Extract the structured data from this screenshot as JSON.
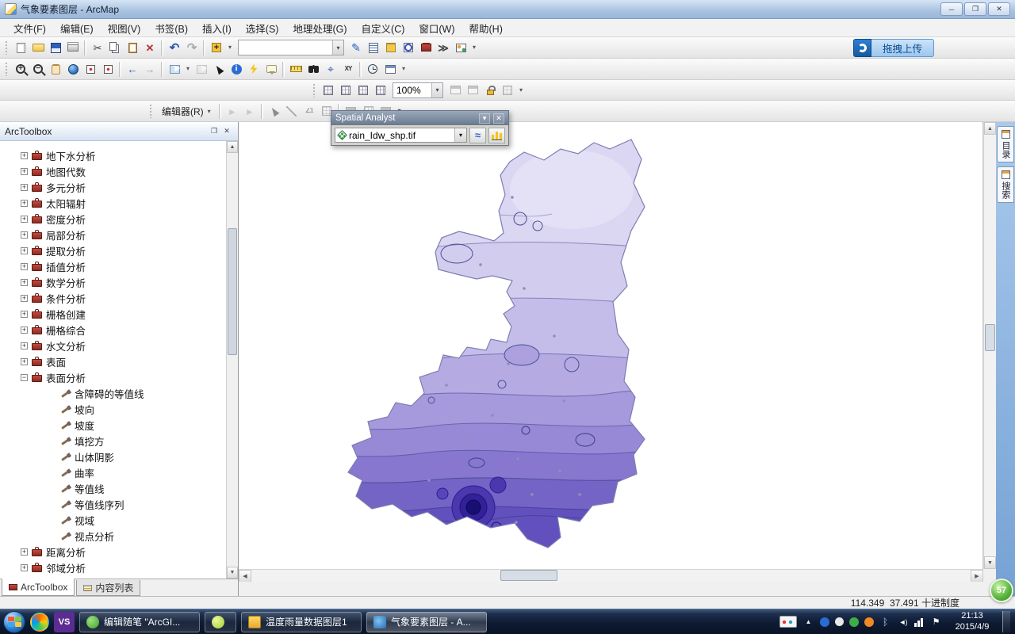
{
  "glyphs": {
    "drop": "▾",
    "close": "✕",
    "min": "─",
    "max": "❐",
    "up": "▲",
    "down": "▼",
    "left": "◀",
    "right": "▶",
    "windowed": "❐"
  },
  "window": {
    "title": "气象要素图层 - ArcMap"
  },
  "menu": {
    "items": [
      "文件(F)",
      "编辑(E)",
      "视图(V)",
      "书签(B)",
      "插入(I)",
      "选择(S)",
      "地理处理(G)",
      "自定义(C)",
      "窗口(W)",
      "帮助(H)"
    ]
  },
  "upload": {
    "label": "拖拽上传"
  },
  "toolbar1": {
    "scale_value": "",
    "left": [
      {
        "name": "new-document-button",
        "cls": "ic-new"
      },
      {
        "name": "open-button",
        "cls": "ic-open"
      },
      {
        "name": "save-button",
        "cls": "ic-save"
      },
      {
        "name": "print-button",
        "cls": "ic-print"
      },
      {
        "name": "toolbar-separator",
        "cls": "tsep",
        "inter": "false"
      },
      {
        "name": "cut-button",
        "cls": "ic-cut",
        "glyph": "✂"
      },
      {
        "name": "copy-button",
        "cls": "ic-copy"
      },
      {
        "name": "paste-button",
        "cls": "ic-paste"
      },
      {
        "name": "delete-button",
        "cls": "ic-del",
        "glyph": "✕"
      },
      {
        "name": "toolbar-separator",
        "cls": "tsep",
        "inter": "false"
      },
      {
        "name": "undo-button",
        "cls": "ic-undo",
        "glyph": "↶"
      },
      {
        "name": "redo-button",
        "cls": "ic-redo",
        "glyph": "↷"
      },
      {
        "name": "toolbar-separator",
        "cls": "tsep",
        "inter": "false"
      },
      {
        "name": "add-data-button",
        "cls": "ic-adddata",
        "glyph": "+"
      },
      {
        "name": "add-data-dropdown",
        "cls": "tdrop",
        "glyph": "▾"
      }
    ],
    "right": [
      {
        "name": "editor-toggle-button",
        "cls": "ic-pencil",
        "glyph": "✎"
      },
      {
        "name": "table-of-contents-button",
        "cls": "ic-toc"
      },
      {
        "name": "catalog-window-button",
        "cls": "ic-catalog"
      },
      {
        "name": "search-window-button",
        "cls": "ic-searchwin"
      },
      {
        "name": "arctoolbox-window-button",
        "cls": "ic-toolboxred"
      },
      {
        "name": "python-window-button",
        "cls": "ic-python",
        "glyph": "≫"
      },
      {
        "name": "modelbuilder-button",
        "cls": "ic-model"
      },
      {
        "name": "standard-toolbar-dropdown",
        "cls": "tdrop",
        "glyph": "▾"
      }
    ]
  },
  "toolbar2": {
    "icons": [
      {
        "name": "zoom-in-button",
        "cls": "ic-zoomin",
        "glyph": "+"
      },
      {
        "name": "zoom-out-button",
        "cls": "ic-zoomout",
        "glyph": "−"
      },
      {
        "name": "pan-button",
        "cls": "ic-hand"
      },
      {
        "name": "full-extent-button",
        "cls": "ic-globe"
      },
      {
        "name": "fixed-zoom-in-button",
        "cls": "ic-fz"
      },
      {
        "name": "fixed-zoom-out-button",
        "cls": "ic-fz"
      },
      {
        "name": "toolbar-separator",
        "cls": "tsep",
        "inter": "false"
      },
      {
        "name": "back-extent-button",
        "cls": "ic-blue",
        "glyph": "←"
      },
      {
        "name": "forward-extent-button",
        "cls": "ic-gray",
        "glyph": "→"
      },
      {
        "name": "toolbar-separator",
        "cls": "tsep",
        "inter": "false"
      },
      {
        "name": "select-features-button",
        "cls": "ic-selfeat"
      },
      {
        "name": "select-features-dropdown",
        "cls": "tdrop",
        "glyph": "▾"
      },
      {
        "name": "clear-selection-button",
        "cls": "ic-selfeat dim"
      },
      {
        "name": "select-elements-button",
        "cls": "ic-cursor"
      },
      {
        "name": "identify-button",
        "cls": "ic-info",
        "glyph": "i"
      },
      {
        "name": "hyperlink-button",
        "cls": "ic-lightning"
      },
      {
        "name": "html-popup-button",
        "cls": "ic-popup"
      },
      {
        "name": "toolbar-separator",
        "cls": "tsep",
        "inter": "false"
      },
      {
        "name": "measure-button",
        "cls": "ic-ruler"
      },
      {
        "name": "find-button",
        "cls": "ic-binoc"
      },
      {
        "name": "find-route-button",
        "cls": "ic-route",
        "glyph": "⌖"
      },
      {
        "name": "go-to-xy-button",
        "cls": "ic-xy",
        "glyph": "XY"
      },
      {
        "name": "toolbar-separator",
        "cls": "tsep",
        "inter": "false"
      },
      {
        "name": "time-slider-button",
        "cls": "ic-clockcss"
      },
      {
        "name": "viewer-window-button",
        "cls": "ic-viewer"
      },
      {
        "name": "tools-toolbar-dropdown",
        "cls": "tdrop",
        "glyph": "▾"
      }
    ]
  },
  "toolbar3": {
    "zoom_value": "100%",
    "left": [
      {
        "name": "zoom-whole-page-button",
        "cls": "ic-grid"
      },
      {
        "name": "zoom-100-button",
        "cls": "ic-grid"
      },
      {
        "name": "zoom-page-width-button",
        "cls": "ic-grid"
      },
      {
        "name": "toggle-draft-mode-button",
        "cls": "ic-grid"
      }
    ],
    "right": [
      {
        "name": "focus-data-frame-button",
        "cls": "ic-viewer dim"
      },
      {
        "name": "change-layout-button",
        "cls": "ic-viewer dim"
      },
      {
        "name": "lock-pan-zoom-button",
        "cls": "ic-lock"
      },
      {
        "name": "data-driven-pages-button",
        "cls": "ic-grid dim"
      },
      {
        "name": "layout-toolbar-dropdown",
        "cls": "tdrop",
        "glyph": "▾"
      }
    ]
  },
  "editor_toolbar": {
    "label": "编辑器(R)",
    "icons": [
      {
        "name": "editor-prev-button",
        "cls": "ic-gray dim",
        "glyph": "▸"
      },
      {
        "name": "editor-next-button",
        "cls": "ic-gray dim",
        "glyph": "▸"
      },
      {
        "name": "toolbar-separator",
        "cls": "tsep",
        "inter": "false"
      },
      {
        "name": "edit-tool-button",
        "cls": "ic-cursor dim"
      },
      {
        "name": "straight-segment-button",
        "cls": "ic-line dim"
      },
      {
        "name": "construction-tool-button",
        "cls": "ic-xy dim",
        "glyph": "∠1"
      },
      {
        "name": "trace-tool-button",
        "cls": "ic-grid dim"
      },
      {
        "name": "toolbar-separator",
        "cls": "tsep",
        "inter": "false"
      },
      {
        "name": "attributes-button",
        "cls": "ic-viewer dim"
      },
      {
        "name": "sketch-properties-button",
        "cls": "ic-grid dim"
      },
      {
        "name": "create-features-button",
        "cls": "ic-viewer dim"
      },
      {
        "name": "editor-toolbar-dropdown",
        "cls": "tdrop",
        "glyph": "▾"
      }
    ]
  },
  "spatial_analyst": {
    "title": "Spatial Analyst",
    "layer_value": "rain_Idw_shp.tif"
  },
  "arctoolbox": {
    "title": "ArcToolbox",
    "items": [
      {
        "label": "地下水分析",
        "kind": "lvl0",
        "expander": "plus",
        "icon": "toolbox",
        "icname": "toolbox-icon"
      },
      {
        "label": "地图代数",
        "kind": "lvl0",
        "expander": "plus",
        "icon": "toolbox",
        "icname": "toolbox-icon"
      },
      {
        "label": "多元分析",
        "kind": "lvl0",
        "expander": "plus",
        "icon": "toolbox",
        "icname": "toolbox-icon"
      },
      {
        "label": "太阳辐射",
        "kind": "lvl0",
        "expander": "plus",
        "icon": "toolbox",
        "icname": "toolbox-icon"
      },
      {
        "label": "密度分析",
        "kind": "lvl0",
        "expander": "plus",
        "icon": "toolbox",
        "icname": "toolbox-icon"
      },
      {
        "label": "局部分析",
        "kind": "lvl0",
        "expander": "plus",
        "icon": "toolbox",
        "icname": "toolbox-icon"
      },
      {
        "label": "提取分析",
        "kind": "lvl0",
        "expander": "plus",
        "icon": "toolbox",
        "icname": "toolbox-icon"
      },
      {
        "label": "插值分析",
        "kind": "lvl0",
        "expander": "plus",
        "icon": "toolbox",
        "icname": "toolbox-icon"
      },
      {
        "label": "数学分析",
        "kind": "lvl0",
        "expander": "plus",
        "icon": "toolbox",
        "icname": "toolbox-icon"
      },
      {
        "label": "条件分析",
        "kind": "lvl0",
        "expander": "plus",
        "icon": "toolbox",
        "icname": "toolbox-icon"
      },
      {
        "label": "栅格创建",
        "kind": "lvl0",
        "expander": "plus",
        "icon": "toolbox",
        "icname": "toolbox-icon"
      },
      {
        "label": "栅格综合",
        "kind": "lvl0",
        "expander": "plus",
        "icon": "toolbox",
        "icname": "toolbox-icon"
      },
      {
        "label": "水文分析",
        "kind": "lvl0",
        "expander": "plus",
        "icon": "toolbox",
        "icname": "toolbox-icon"
      },
      {
        "label": "表面",
        "kind": "lvl0",
        "expander": "plus",
        "icon": "toolbox",
        "icname": "toolbox-icon"
      },
      {
        "label": "表面分析",
        "kind": "lvl0",
        "expander": "minus",
        "icon": "toolbox",
        "icname": "toolbox-icon"
      },
      {
        "label": "含障碍的等值线",
        "kind": "lvl1",
        "expander": "none",
        "icon": "tool",
        "icname": "tool-hammer-icon"
      },
      {
        "label": "坡向",
        "kind": "lvl1",
        "expander": "none",
        "icon": "tool",
        "icname": "tool-hammer-icon"
      },
      {
        "label": "坡度",
        "kind": "lvl1",
        "expander": "none",
        "icon": "tool",
        "icname": "tool-hammer-icon"
      },
      {
        "label": "填挖方",
        "kind": "lvl1",
        "expander": "none",
        "icon": "tool",
        "icname": "tool-hammer-icon"
      },
      {
        "label": "山体阴影",
        "kind": "lvl1",
        "expander": "none",
        "icon": "tool",
        "icname": "tool-hammer-icon"
      },
      {
        "label": "曲率",
        "kind": "lvl1",
        "expander": "none",
        "icon": "tool",
        "icname": "tool-hammer-icon"
      },
      {
        "label": "等值线",
        "kind": "lvl1",
        "expander": "none",
        "icon": "tool",
        "icname": "tool-hammer-icon"
      },
      {
        "label": "等值线序列",
        "kind": "lvl1",
        "expander": "none",
        "icon": "tool",
        "icname": "tool-hammer-icon"
      },
      {
        "label": "视域",
        "kind": "lvl1",
        "expander": "none",
        "icon": "tool",
        "icname": "tool-hammer-icon"
      },
      {
        "label": "视点分析",
        "kind": "lvl1",
        "expander": "none",
        "icon": "tool",
        "icname": "tool-hammer-icon"
      },
      {
        "label": "距离分析",
        "kind": "lvl0",
        "expander": "plus",
        "icon": "toolbox",
        "icname": "toolbox-icon"
      },
      {
        "label": "邻域分析",
        "kind": "lvl0",
        "expander": "plus",
        "icon": "toolbox",
        "icname": "toolbox-icon"
      }
    ],
    "tabs": [
      {
        "label": "ArcToolbox",
        "cls": "active",
        "icon": "tab-red"
      },
      {
        "label": "内容列表",
        "cls": "",
        "icon": "tab-list"
      }
    ]
  },
  "right_dock": {
    "tabs": [
      {
        "label": "目录"
      },
      {
        "label": "搜索"
      }
    ]
  },
  "map": {
    "palette": [
      "#e4e1f7",
      "#d2ccee",
      "#c5bde9",
      "#b5abe2",
      "#a699dc",
      "#9789d5",
      "#8777ce",
      "#7464c6",
      "#6150bd",
      "#4b38ae",
      "#33209b",
      "#190f72"
    ],
    "contour_color": "#4a4f96"
  },
  "statusbar": {
    "text": "114.349  37.491 十进制度"
  },
  "overlay": {
    "speed_value": "57"
  },
  "taskbar": {
    "pinned": [
      {
        "name": "sogou-browser-icon",
        "cls": "pin-sogou",
        "glyph": ""
      },
      {
        "name": "visual-studio-icon",
        "cls": "pin-vs",
        "glyph": "VS"
      }
    ],
    "windows": [
      {
        "label": "编辑随笔 \"ArcGI...",
        "icon": "wi-green",
        "cls": "",
        "iname": "taskbar-window-blog-editor"
      },
      {
        "label": "",
        "icon": "wi-360",
        "cls": "iconbtn",
        "iname": "taskbar-icon-browser"
      },
      {
        "label": "温度雨量数据图层1",
        "icon": "wi-layers",
        "cls": "",
        "iname": "taskbar-window-temperature-rain-layers"
      },
      {
        "label": "气象要素图层 - A...",
        "icon": "wi-map",
        "cls": "active",
        "iname": "taskbar-window-arcmap"
      }
    ],
    "tray": {
      "icons": [
        {
          "name": "ime-icon",
          "cls": "tr-ime"
        },
        {
          "name": "hidden-icons-chevron",
          "cls": "tr-chev",
          "glyph": "▲"
        },
        {
          "name": "shield-icon",
          "cls": "tr-blue"
        },
        {
          "name": "gear-icon",
          "cls": "tr-white"
        },
        {
          "name": "safety-icon",
          "cls": "tr-green"
        },
        {
          "name": "update-icon",
          "cls": "tr-orange"
        },
        {
          "name": "bluetooth-icon",
          "cls": "tr-bt",
          "glyph": "ᛒ"
        },
        {
          "name": "volume-icon",
          "cls": "tr-vol",
          "glyph": "◄)"
        },
        {
          "name": "network-icon",
          "cls": "tr-net"
        },
        {
          "name": "action-center-flag-icon",
          "cls": "tr-flag",
          "glyph": "⚑"
        }
      ],
      "time": "21:13",
      "date": "2015/4/9"
    }
  }
}
